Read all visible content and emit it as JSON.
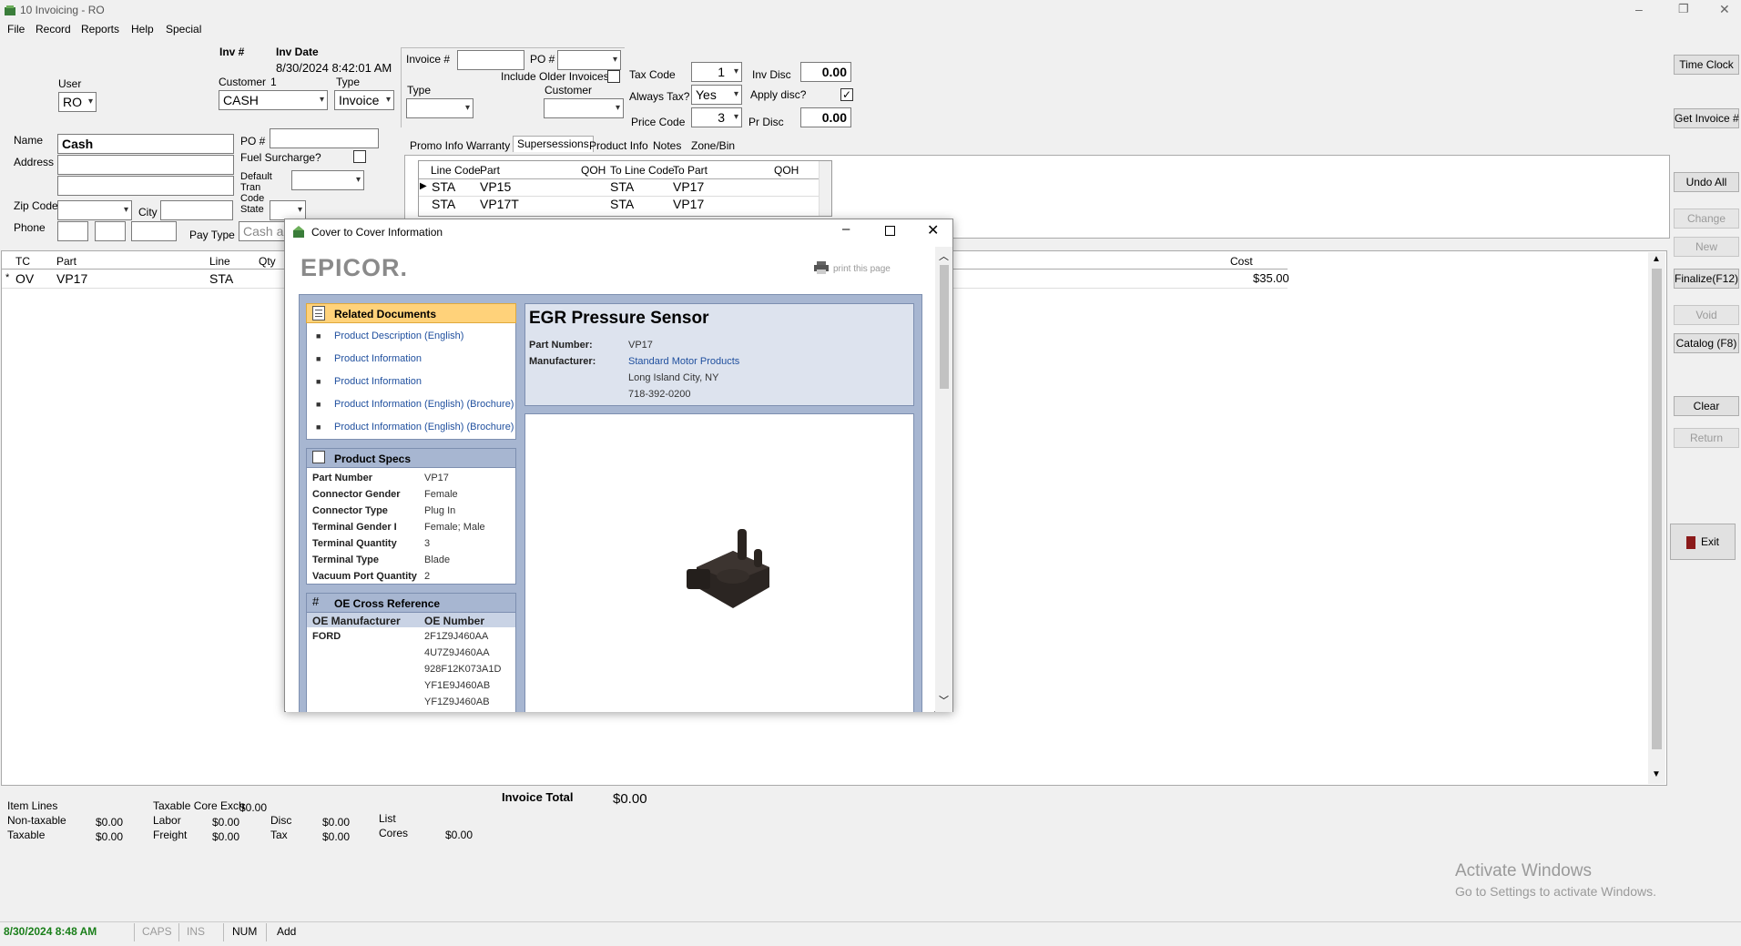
{
  "window": {
    "title": "10 Invoicing - RO",
    "min_label": "–",
    "restore_label": "❐",
    "close_label": "✕"
  },
  "menu": [
    "File",
    "Record",
    "Reports",
    "Help",
    "Special"
  ],
  "header": {
    "user_label": "User",
    "user_value": "RO",
    "inv_num_label": "Inv #",
    "inv_date_label": "Inv Date",
    "inv_date_value": "8/30/2024 8:42:01 AM",
    "customer_label": "Customer",
    "customer_num": "1",
    "customer_value": "CASH",
    "type_label": "Type",
    "type_value": "Invoice"
  },
  "invoice_lookup": {
    "invoice_num_label": "Invoice #",
    "invoice_num_value": "",
    "po_label": "PO #",
    "po_value": "",
    "include_older_label": "Include Older Invoices?",
    "type_label": "Type",
    "type_value": "",
    "customer_label": "Customer",
    "customer_value": ""
  },
  "tax": {
    "tax_code_label": "Tax Code",
    "tax_code_value": "1",
    "always_tax_label": "Always Tax?",
    "always_tax_value": "Yes",
    "price_code_label": "Price Code",
    "price_code_value": "3",
    "inv_disc_label": "Inv Disc",
    "inv_disc_value": "0.00",
    "apply_disc_label": "Apply disc?",
    "apply_disc_check": "✓",
    "pr_disc_label": "Pr Disc",
    "pr_disc_value": "0.00"
  },
  "customer_info": {
    "name_label": "Name",
    "name_value": "Cash",
    "address_label": "Address",
    "zip_label": "Zip Code",
    "city_label": "City",
    "phone_label": "Phone",
    "po_label": "PO #",
    "fuel_label": "Fuel Surcharge?",
    "default_tran_label_1": "Default",
    "default_tran_label_2": "Tran",
    "default_tran_label_3": "Code",
    "state_label": "State",
    "pay_type_label": "Pay Type",
    "pay_type_value": "Cash ar"
  },
  "tabs": [
    "Promo Info",
    "Warranty",
    "Supersessions",
    "Product Info",
    "Notes",
    "Zone/Bin"
  ],
  "supersessions": {
    "headers": [
      "Line Code",
      "Part",
      "QOH",
      "To Line Code",
      "To Part",
      "QOH"
    ],
    "rows": [
      [
        "STA",
        "VP15",
        "",
        "STA",
        "VP17",
        ""
      ],
      [
        "STA",
        "VP17T",
        "",
        "STA",
        "VP17",
        ""
      ]
    ],
    "row_marker": "▶"
  },
  "lines_grid": {
    "headers": [
      "TC",
      "Part",
      "Line",
      "Qty",
      "Cost"
    ],
    "row": {
      "marker": "*",
      "tc": "OV",
      "part": "VP17",
      "line": "STA",
      "cost": "$35.00"
    }
  },
  "right_buttons": {
    "time_clock": "Time Clock",
    "get_invoice": "Get Invoice #",
    "undo_all": "Undo All",
    "change": "Change",
    "new": "New",
    "finalize": "Finalize(F12)",
    "void": "Void",
    "catalog": "Catalog (F8)",
    "clear": "Clear",
    "return": "Return",
    "exit": "Exit"
  },
  "totals": {
    "item_lines_label": "Item Lines",
    "nontaxable_label": "Non-taxable",
    "nontaxable_value": "$0.00",
    "taxable_label": "Taxable",
    "taxable_value": "$0.00",
    "taxable_core_label": "Taxable Core Exch",
    "taxable_core_value": "$0.00",
    "labor_label": "Labor",
    "labor_value": "$0.00",
    "freight_label": "Freight",
    "freight_value": "$0.00",
    "disc_label": "Disc",
    "disc_value": "$0.00",
    "tax_label": "Tax",
    "tax_value": "$0.00",
    "list_label": "List",
    "cores_label": "Cores",
    "cores_value": "$0.00",
    "invoice_total_label": "Invoice Total",
    "invoice_total_value": "$0.00"
  },
  "watermark": {
    "line1": "Activate Windows",
    "line2": "Go to Settings to activate Windows."
  },
  "status_bar": {
    "datetime": "8/30/2024 8:48 AM",
    "caps": "CAPS",
    "ins": "INS",
    "num": "NUM",
    "mode": "Add"
  },
  "dialog": {
    "title": "Cover to Cover Information",
    "logo": "EPICOR.",
    "print_label": "print this page",
    "related_docs_title": "Related Documents",
    "related_docs": [
      "Product Description (English)",
      "Product Information",
      "Product Information",
      "Product Information (English) (Brochure)",
      "Product Information (English) (Brochure)"
    ],
    "product_specs_title": "Product Specs",
    "product_specs": [
      {
        "k": "Part Number",
        "v": "VP17"
      },
      {
        "k": "Connector Gender",
        "v": "Female"
      },
      {
        "k": "Connector Type",
        "v": "Plug In"
      },
      {
        "k": "Terminal Gender I",
        "v": "Female; Male"
      },
      {
        "k": "Terminal Quantity",
        "v": "3"
      },
      {
        "k": "Terminal Type",
        "v": "Blade"
      },
      {
        "k": "Vacuum Port Quantity",
        "v": "2"
      }
    ],
    "oe_title": "OE Cross Reference",
    "oe_col1": "OE Manufacturer",
    "oe_col2": "OE Number",
    "oe_manufacturer": "FORD",
    "oe_numbers": [
      "2F1Z9J460AA",
      "4U7Z9J460AA",
      "928F12K073A1D",
      "YF1E9J460AB",
      "YF1Z9J460AB"
    ],
    "product_title": "EGR Pressure Sensor",
    "part_number_label": "Part Number:",
    "part_number_value": "VP17",
    "manufacturer_label": "Manufacturer:",
    "manufacturer_value": "Standard Motor Products",
    "mfr_city": "Long Island City, NY",
    "mfr_phone": "718-392-0200"
  }
}
